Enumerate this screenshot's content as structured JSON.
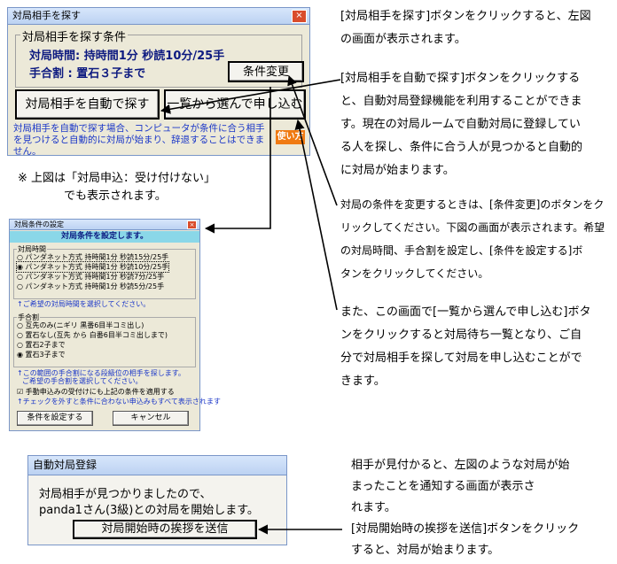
{
  "search_window": {
    "title": "対局相手を探す",
    "group_title": "対局相手を探す条件",
    "time_line": "対局時間:  持時間1分  秒読10分/25手",
    "handicap_line": "手合割   :  置石３子まで",
    "change_button": "条件変更",
    "auto_button": "対局相手を自動で探す",
    "list_button": "一覧から選んで申し込む",
    "help_text": "対局相手を自動で探す場合、コンピュータが条件に合う相手を見つけると自動的に対局が始まり、辞退することはできません。",
    "help_badge": "使い方"
  },
  "caption_under": [
    "※ 上図は「対局申込：受け付けない」",
    "でも表示されます。"
  ],
  "condition_window": {
    "title": "対局条件の設定",
    "header": "対局条件を設定します。",
    "time_group": "対局時間",
    "time_options": [
      {
        "label": "パンダネット方式 持時間1分 秒読15分/25手",
        "checked": false
      },
      {
        "label": "パンダネット方式 持時間1分 秒読10分/25手",
        "checked": true
      },
      {
        "label": "パンダネット方式 持時間1分 秒読7分/25手",
        "checked": false
      },
      {
        "label": "パンダネット方式 持時間1分 秒読5分/25手",
        "checked": false
      }
    ],
    "time_hint": "↑ご希望の対局時間を選択してください。",
    "handicap_group": "手合割",
    "handicap_options": [
      {
        "label": "互先のみ(ニギリ 黒番6目半コミ出し)",
        "checked": false
      },
      {
        "label": "置石なし(互先 から 白番6目半コミ出しまで)",
        "checked": false
      },
      {
        "label": "置石2子まで",
        "checked": false
      },
      {
        "label": "置石3子まで",
        "checked": true
      }
    ],
    "handicap_hint": [
      "↑この範囲の手合割になる段級位の相手を探します。",
      "ご希望の手合割を選択してください。"
    ],
    "apply_checkbox": "手動申込みの受付けにも上記の条件を適用する",
    "apply_hint": "↑チェックを外すと条件に合わない申込みもすべて表示されます",
    "set_button": "条件を設定する",
    "cancel_button": "キャンセル"
  },
  "auto_window": {
    "title": "自動対局登録",
    "message_line1": "対局相手が見つかりましたので、",
    "message_line2": "panda1さん(3級)との対局を開始します。",
    "greet_button": "対局開始時の挨拶を送信"
  },
  "notes": {
    "n1": [
      "[対局相手を探す]ボタンをクリックすると、左図",
      "の画面が表示されます。"
    ],
    "n2": [
      "[対局相手を自動で探す]ボタンをクリックする",
      "と、自動対局登録機能を利用することができま",
      "す。現在の対局ルームで自動対局に登録してい",
      "る人を探し、条件に合う人が見つかると自動的",
      "に対局が始まります。"
    ],
    "n3": [
      "対局の条件を変更するときは、[条件変更]のボタンをク",
      "リックしてください。下図の画面が表示されます。希望",
      "の対局時間、手合割を設定し、[条件を設定する]ボ",
      "タンをクリックしてください。"
    ],
    "n4": [
      "また、この画面で[一覧から選んで申し込む]ボタ",
      "ンをクリックすると対局待ち一覧となり、ご自",
      "分で対局相手を探して対局を申し込むことがで",
      "きます。"
    ],
    "n5": [
      "相手が見付かると、左図のような対局が始",
      "まったことを通知する画面が表示さ",
      "れます。",
      "[対局開始時の挨拶を送信]ボタンをクリック",
      "すると、対局が始まります。"
    ]
  }
}
